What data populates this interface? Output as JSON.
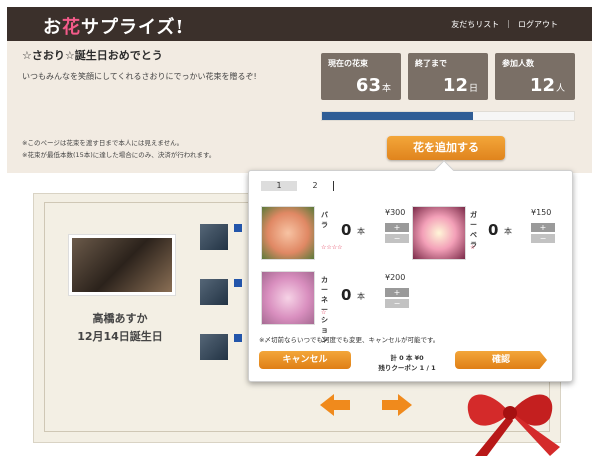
{
  "header": {
    "logo_prefix": "お",
    "logo_hana": "花",
    "logo_suffix": "サプライズ!",
    "nav": [
      "友だちリスト",
      "|",
      "ログアウト"
    ]
  },
  "event": {
    "title": "☆さおり☆誕生日おめでとう",
    "message": "いつもみんなを笑顔にしてくれるさおりにでっかい花束を贈るぞ!",
    "notes": [
      "※このページは花束を渡す日まで本人には見えません。",
      "※花束が最低本数(15本)に達した場合にのみ、決済が行われます。"
    ],
    "stats": [
      {
        "label": "現在の花束",
        "value": "63",
        "unit": "本"
      },
      {
        "label": "終了まで",
        "value": "12",
        "unit": "日"
      },
      {
        "label": "参加人数",
        "value": "12",
        "unit": "人"
      }
    ],
    "progress_fraction": 0.6,
    "add_button": "花を追加する"
  },
  "recipient": {
    "name": "高橋あすか",
    "birthday": "12月14日誕生日"
  },
  "popup": {
    "pages": [
      "1",
      "2"
    ],
    "flowers": [
      {
        "name": "バラ",
        "price": "¥300",
        "qty": "0",
        "unit": "本",
        "stars": "☆☆☆☆",
        "plus": "+",
        "minus": "−"
      },
      {
        "name": "ガーベラ",
        "price": "¥150",
        "qty": "0",
        "unit": "本",
        "stars": "☆",
        "plus": "+",
        "minus": "−"
      },
      {
        "name": "カーネーション",
        "price": "¥200",
        "qty": "0",
        "unit": "本",
        "stars": "☆",
        "plus": "+",
        "minus": "−"
      }
    ],
    "note": "※〆切前ならいつでも何度でも変更、キャンセルが可能です。",
    "cancel": "キャンセル",
    "confirm": "確認",
    "total": "計 0 本 ¥0",
    "coupon": "残りクーポン 1 / 1"
  },
  "colors": {
    "header_bg": "#3b302b",
    "accent_orange": "#e8901f",
    "progress_fill": "#2f5d96",
    "logo_pink": "#f45b8a"
  }
}
